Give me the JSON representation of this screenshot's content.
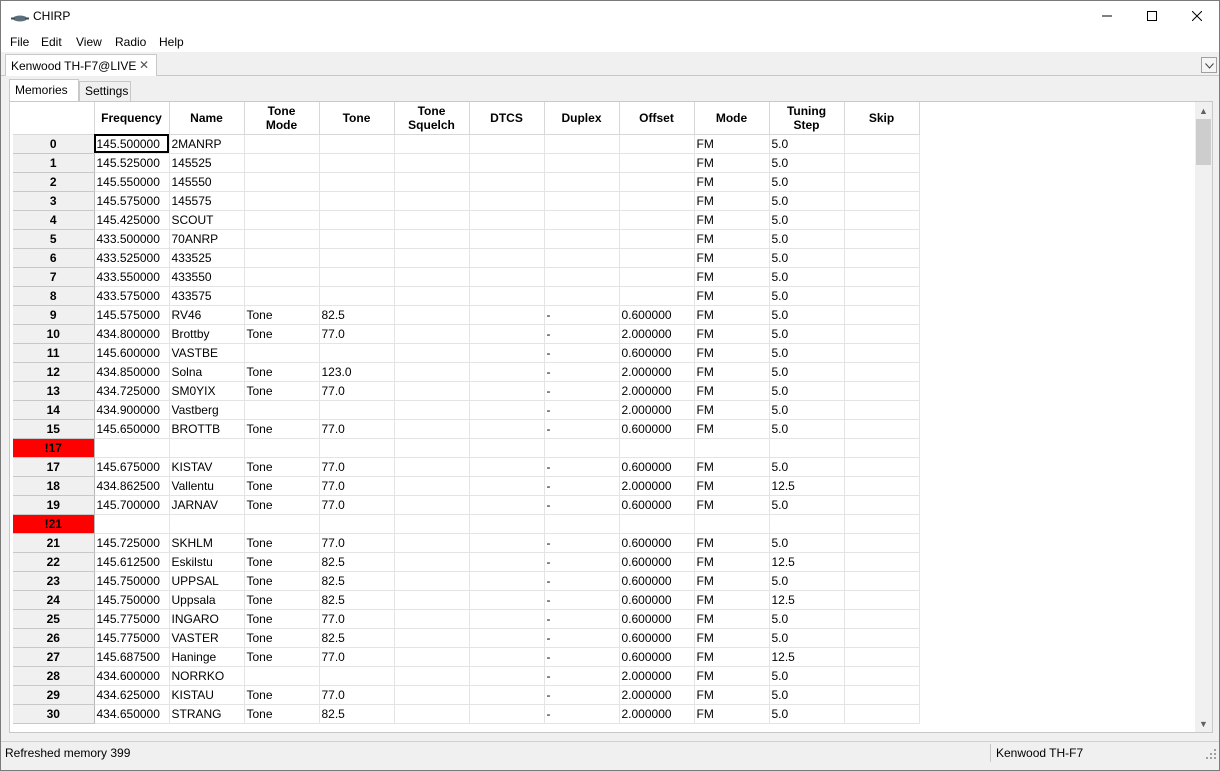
{
  "window": {
    "title": "CHIRP",
    "icon": "chirp-radio-icon",
    "controls": {
      "minimize": "minimize-icon",
      "maximize": "maximize-icon",
      "close": "close-icon"
    }
  },
  "menubar": {
    "items": [
      "File",
      "Edit",
      "View",
      "Radio",
      "Help"
    ]
  },
  "document_tab": {
    "label": "Kenwood TH-F7@LIVE",
    "close_glyph": "✕"
  },
  "inner_tabs": [
    {
      "label": "Memories",
      "active": true
    },
    {
      "label": "Settings",
      "active": false
    }
  ],
  "grid": {
    "columns": [
      {
        "label": "Frequency",
        "lines": [
          "Frequency"
        ]
      },
      {
        "label": "Name",
        "lines": [
          "Name"
        ]
      },
      {
        "label": "Tone Mode",
        "lines": [
          "Tone",
          "Mode"
        ]
      },
      {
        "label": "Tone",
        "lines": [
          "Tone"
        ]
      },
      {
        "label": "Tone Squelch",
        "lines": [
          "Tone",
          "Squelch"
        ]
      },
      {
        "label": "DTCS",
        "lines": [
          "DTCS"
        ]
      },
      {
        "label": "Duplex",
        "lines": [
          "Duplex"
        ]
      },
      {
        "label": "Offset",
        "lines": [
          "Offset"
        ]
      },
      {
        "label": "Mode",
        "lines": [
          "Mode"
        ]
      },
      {
        "label": "Tuning Step",
        "lines": [
          "Tuning",
          "Step"
        ]
      },
      {
        "label": "Skip",
        "lines": [
          "Skip"
        ]
      }
    ],
    "selected_cell": {
      "row": "0",
      "column": "Frequency"
    },
    "rows": [
      {
        "num": "0",
        "invalid": false,
        "cells": [
          "145.500000",
          "2MANRP",
          "",
          "",
          "",
          "",
          "",
          "",
          "FM",
          "5.0",
          ""
        ]
      },
      {
        "num": "1",
        "invalid": false,
        "cells": [
          "145.525000",
          "145525",
          "",
          "",
          "",
          "",
          "",
          "",
          "FM",
          "5.0",
          ""
        ]
      },
      {
        "num": "2",
        "invalid": false,
        "cells": [
          "145.550000",
          "145550",
          "",
          "",
          "",
          "",
          "",
          "",
          "FM",
          "5.0",
          ""
        ]
      },
      {
        "num": "3",
        "invalid": false,
        "cells": [
          "145.575000",
          "145575",
          "",
          "",
          "",
          "",
          "",
          "",
          "FM",
          "5.0",
          ""
        ]
      },
      {
        "num": "4",
        "invalid": false,
        "cells": [
          "145.425000",
          "SCOUT",
          "",
          "",
          "",
          "",
          "",
          "",
          "FM",
          "5.0",
          ""
        ]
      },
      {
        "num": "5",
        "invalid": false,
        "cells": [
          "433.500000",
          "70ANRP",
          "",
          "",
          "",
          "",
          "",
          "",
          "FM",
          "5.0",
          ""
        ]
      },
      {
        "num": "6",
        "invalid": false,
        "cells": [
          "433.525000",
          "433525",
          "",
          "",
          "",
          "",
          "",
          "",
          "FM",
          "5.0",
          ""
        ]
      },
      {
        "num": "7",
        "invalid": false,
        "cells": [
          "433.550000",
          "433550",
          "",
          "",
          "",
          "",
          "",
          "",
          "FM",
          "5.0",
          ""
        ]
      },
      {
        "num": "8",
        "invalid": false,
        "cells": [
          "433.575000",
          "433575",
          "",
          "",
          "",
          "",
          "",
          "",
          "FM",
          "5.0",
          ""
        ]
      },
      {
        "num": "9",
        "invalid": false,
        "cells": [
          "145.575000",
          "RV46",
          "Tone",
          "82.5",
          "",
          "",
          "-",
          "0.600000",
          "FM",
          "5.0",
          ""
        ]
      },
      {
        "num": "10",
        "invalid": false,
        "cells": [
          "434.800000",
          "Brottby",
          "Tone",
          "77.0",
          "",
          "",
          "-",
          "2.000000",
          "FM",
          "5.0",
          ""
        ]
      },
      {
        "num": "11",
        "invalid": false,
        "cells": [
          "145.600000",
          "VASTBE",
          "",
          "",
          "",
          "",
          "-",
          "0.600000",
          "FM",
          "5.0",
          ""
        ]
      },
      {
        "num": "12",
        "invalid": false,
        "cells": [
          "434.850000",
          "Solna",
          "Tone",
          "123.0",
          "",
          "",
          "-",
          "2.000000",
          "FM",
          "5.0",
          ""
        ]
      },
      {
        "num": "13",
        "invalid": false,
        "cells": [
          "434.725000",
          "SM0YIX",
          "Tone",
          "77.0",
          "",
          "",
          "-",
          "2.000000",
          "FM",
          "5.0",
          ""
        ]
      },
      {
        "num": "14",
        "invalid": false,
        "cells": [
          "434.900000",
          "Vastberg",
          "",
          "",
          "",
          "",
          "-",
          "2.000000",
          "FM",
          "5.0",
          ""
        ]
      },
      {
        "num": "15",
        "invalid": false,
        "cells": [
          "145.650000",
          "BROTTB",
          "Tone",
          "77.0",
          "",
          "",
          "-",
          "0.600000",
          "FM",
          "5.0",
          ""
        ]
      },
      {
        "num": "!17",
        "invalid": true,
        "cells": [
          "",
          "",
          "",
          "",
          "",
          "",
          "",
          "",
          "",
          "",
          ""
        ]
      },
      {
        "num": "17",
        "invalid": false,
        "cells": [
          "145.675000",
          "KISTAV",
          "Tone",
          "77.0",
          "",
          "",
          "-",
          "0.600000",
          "FM",
          "5.0",
          ""
        ]
      },
      {
        "num": "18",
        "invalid": false,
        "cells": [
          "434.862500",
          "Vallentu",
          "Tone",
          "77.0",
          "",
          "",
          "-",
          "2.000000",
          "FM",
          "12.5",
          ""
        ]
      },
      {
        "num": "19",
        "invalid": false,
        "cells": [
          "145.700000",
          "JARNAV",
          "Tone",
          "77.0",
          "",
          "",
          "-",
          "0.600000",
          "FM",
          "5.0",
          ""
        ]
      },
      {
        "num": "!21",
        "invalid": true,
        "cells": [
          "",
          "",
          "",
          "",
          "",
          "",
          "",
          "",
          "",
          "",
          ""
        ]
      },
      {
        "num": "21",
        "invalid": false,
        "cells": [
          "145.725000",
          "SKHLM",
          "Tone",
          "77.0",
          "",
          "",
          "-",
          "0.600000",
          "FM",
          "5.0",
          ""
        ]
      },
      {
        "num": "22",
        "invalid": false,
        "cells": [
          "145.612500",
          "Eskilstu",
          "Tone",
          "82.5",
          "",
          "",
          "-",
          "0.600000",
          "FM",
          "12.5",
          ""
        ]
      },
      {
        "num": "23",
        "invalid": false,
        "cells": [
          "145.750000",
          "UPPSAL",
          "Tone",
          "82.5",
          "",
          "",
          "-",
          "0.600000",
          "FM",
          "5.0",
          ""
        ]
      },
      {
        "num": "24",
        "invalid": false,
        "cells": [
          "145.750000",
          "Uppsala",
          "Tone",
          "82.5",
          "",
          "",
          "-",
          "0.600000",
          "FM",
          "12.5",
          ""
        ]
      },
      {
        "num": "25",
        "invalid": false,
        "cells": [
          "145.775000",
          "INGARO",
          "Tone",
          "77.0",
          "",
          "",
          "-",
          "0.600000",
          "FM",
          "5.0",
          ""
        ]
      },
      {
        "num": "26",
        "invalid": false,
        "cells": [
          "145.775000",
          "VASTER",
          "Tone",
          "82.5",
          "",
          "",
          "-",
          "0.600000",
          "FM",
          "5.0",
          ""
        ]
      },
      {
        "num": "27",
        "invalid": false,
        "cells": [
          "145.687500",
          "Haninge",
          "Tone",
          "77.0",
          "",
          "",
          "-",
          "0.600000",
          "FM",
          "12.5",
          ""
        ]
      },
      {
        "num": "28",
        "invalid": false,
        "cells": [
          "434.600000",
          "NORRKO",
          "",
          "",
          "",
          "",
          "-",
          "2.000000",
          "FM",
          "5.0",
          ""
        ]
      },
      {
        "num": "29",
        "invalid": false,
        "cells": [
          "434.625000",
          "KISTAU",
          "Tone",
          "77.0",
          "",
          "",
          "-",
          "2.000000",
          "FM",
          "5.0",
          ""
        ]
      },
      {
        "num": "30",
        "invalid": false,
        "cells": [
          "434.650000",
          "STRANG",
          "Tone",
          "82.5",
          "",
          "",
          "-",
          "2.000000",
          "FM",
          "5.0",
          ""
        ]
      }
    ],
    "scrollbar": {
      "up_icon": "scroll-up-arrow-icon",
      "down_icon": "scroll-down-arrow-icon"
    }
  },
  "statusbar": {
    "message": "Refreshed memory 399",
    "radio": "Kenwood TH-F7"
  },
  "colors": {
    "invalid_row": "#ff0000",
    "row_header_bg": "#f0f0f0",
    "chrome_bg": "#f0f0f0",
    "grid_bg": "#ffffff"
  }
}
